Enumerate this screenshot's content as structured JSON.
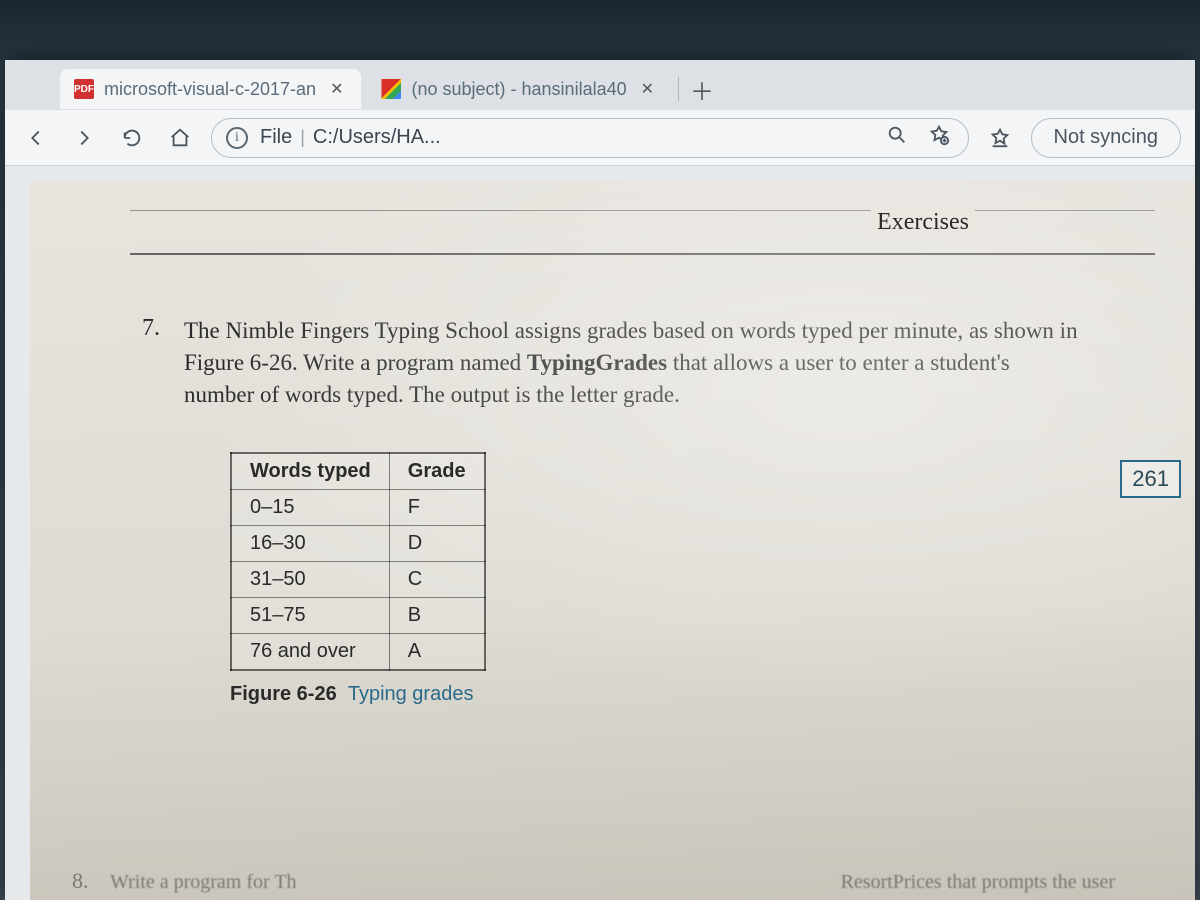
{
  "tabs": [
    {
      "title": "microsoft-visual-c-2017-an",
      "favicon": "pdf"
    },
    {
      "title": "(no subject) - hansinilala40",
      "favicon": "gmail"
    }
  ],
  "toolbar": {
    "scheme_label": "File",
    "path": "C:/Users/HA...",
    "sync_label": "Not syncing"
  },
  "doc": {
    "section_label": "Exercises",
    "page_number": "261",
    "question_number": "7.",
    "question_text_a": "The Nimble Fingers Typing School assigns grades based on words typed per minute, as shown in Figure 6-26. Write a program named ",
    "question_prog": "TypingGrades",
    "question_text_b": " that allows a user to enter a student's number of words typed. The output is the letter grade.",
    "table": {
      "col1": "Words typed",
      "col2": "Grade",
      "rows": [
        {
          "r": "0–15",
          "g": "F"
        },
        {
          "r": "16–30",
          "g": "D"
        },
        {
          "r": "31–50",
          "g": "C"
        },
        {
          "r": "51–75",
          "g": "B"
        },
        {
          "r": "76 and over",
          "g": "A"
        }
      ]
    },
    "figure_label": "Figure 6-26",
    "figure_title": "Typing grades",
    "next_qnum": "8.",
    "cutoff_left": "Write a program for Th",
    "cutoff_right": "ResortPrices that prompts the user"
  }
}
